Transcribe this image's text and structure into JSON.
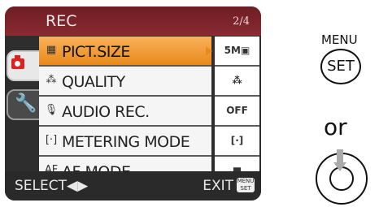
{
  "screen": {
    "title": "REC",
    "page": "2/4",
    "tabs": [
      {
        "name": "rec",
        "icon": "camera-icon"
      },
      {
        "name": "setup",
        "icon": "wrench-icon"
      }
    ],
    "items": [
      {
        "label": "PICT.SIZE",
        "icon": "▦",
        "value": "5M▣",
        "selected": true
      },
      {
        "label": "QUALITY",
        "icon": "⁂",
        "value": "⁂",
        "selected": false
      },
      {
        "label": "AUDIO REC.",
        "icon": "🎙",
        "value": "OFF",
        "selected": false
      },
      {
        "label": "METERING MODE",
        "icon": "[·]",
        "value": "[·]",
        "selected": false
      },
      {
        "label": "AF MODE",
        "icon": "AF",
        "value": "■",
        "selected": false
      }
    ],
    "footer": {
      "select": "SELECT◀▶",
      "exit": "EXIT",
      "badge": "MENU SET"
    }
  },
  "instructions": {
    "menu": "MENU",
    "set": "SET",
    "or": "or"
  },
  "colors": {
    "header": "#7a2229",
    "selected": "#f0a040",
    "body": "#2e2e2e"
  }
}
